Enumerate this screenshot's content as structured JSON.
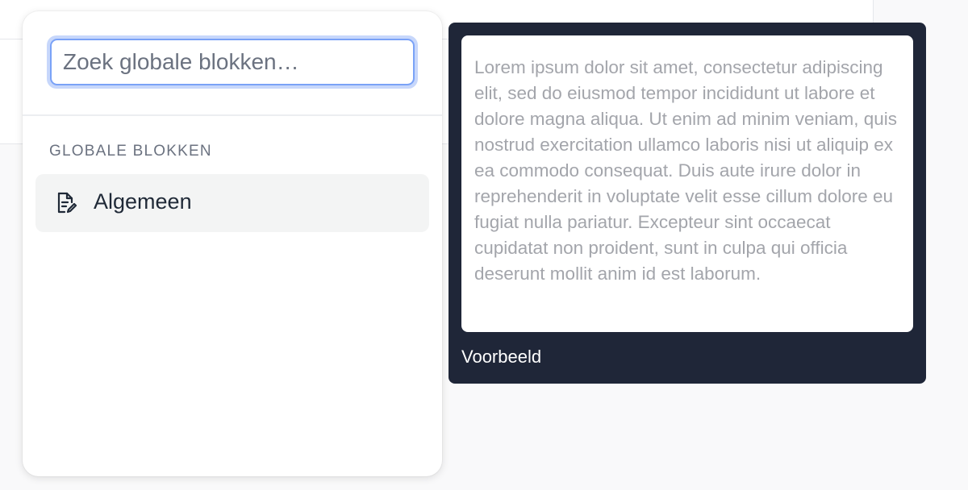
{
  "search": {
    "placeholder": "Zoek globale blokken…",
    "value": ""
  },
  "section": {
    "label": "GLOBALE BLOKKEN"
  },
  "items": [
    {
      "label": "Algemeen",
      "icon": "document-edit-icon"
    }
  ],
  "preview": {
    "text": "Lorem ipsum dolor sit amet, consectetur adipiscing elit, sed do eiusmod tempor incididunt ut labore et dolore magna aliqua. Ut enim ad minim veniam, quis nostrud exercitation ullamco laboris nisi ut aliquip ex ea commodo consequat. Duis aute irure dolor in reprehenderit in voluptate velit esse cillum dolore eu fugiat nulla pariatur. Excepteur sint occaecat cupidatat non proident, sunt in culpa qui officia deserunt mollit anim id est laborum.",
    "caption": "Voorbeeld"
  },
  "colors": {
    "accent": "#7aa2f7",
    "preview_bg": "#1f2638",
    "item_hover_bg": "#f3f4f4"
  }
}
